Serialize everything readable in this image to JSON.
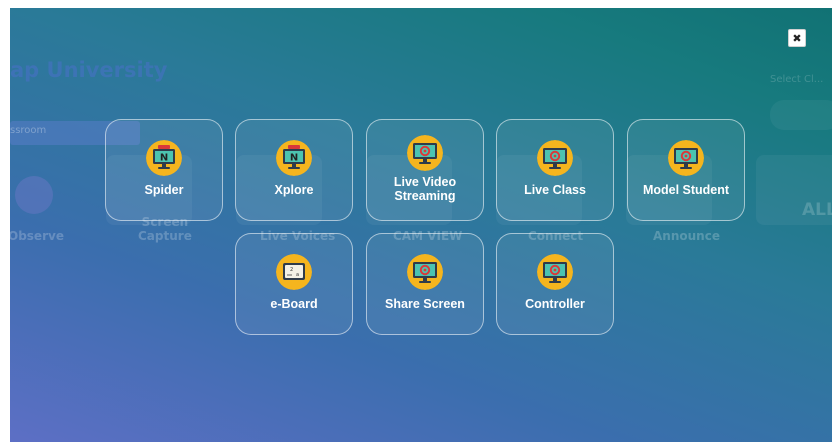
{
  "background_app": {
    "title": "ap University",
    "select_label": "Select Cl...",
    "classroom_field": "ssroom",
    "labels": [
      "Observe",
      "Screen\nCapture",
      "Live Voices",
      "CAM VIEW",
      "Connect",
      "Announce"
    ],
    "all_label": "ALL"
  },
  "tools": [
    {
      "label": "Spider",
      "icon": "monitor-n-icon"
    },
    {
      "label": "Xplore",
      "icon": "monitor-n-icon"
    },
    {
      "label": "Live Video\nStreaming",
      "icon": "monitor-gear-icon"
    },
    {
      "label": "Live Class",
      "icon": "monitor-gear-icon"
    },
    {
      "label": "Model Student",
      "icon": "monitor-gear-icon"
    },
    {
      "label": "e-Board",
      "icon": "whiteboard-icon"
    },
    {
      "label": "Share Screen",
      "icon": "monitor-gear-icon"
    },
    {
      "label": "Controller",
      "icon": "monitor-gear-icon"
    }
  ],
  "close_label": "✖",
  "colors": {
    "gradient_start": "#5d6fc5",
    "gradient_end": "#117274",
    "icon_yellow": "#f5b51e",
    "icon_screen": "#4cc3b0",
    "icon_red": "#d9383a"
  }
}
